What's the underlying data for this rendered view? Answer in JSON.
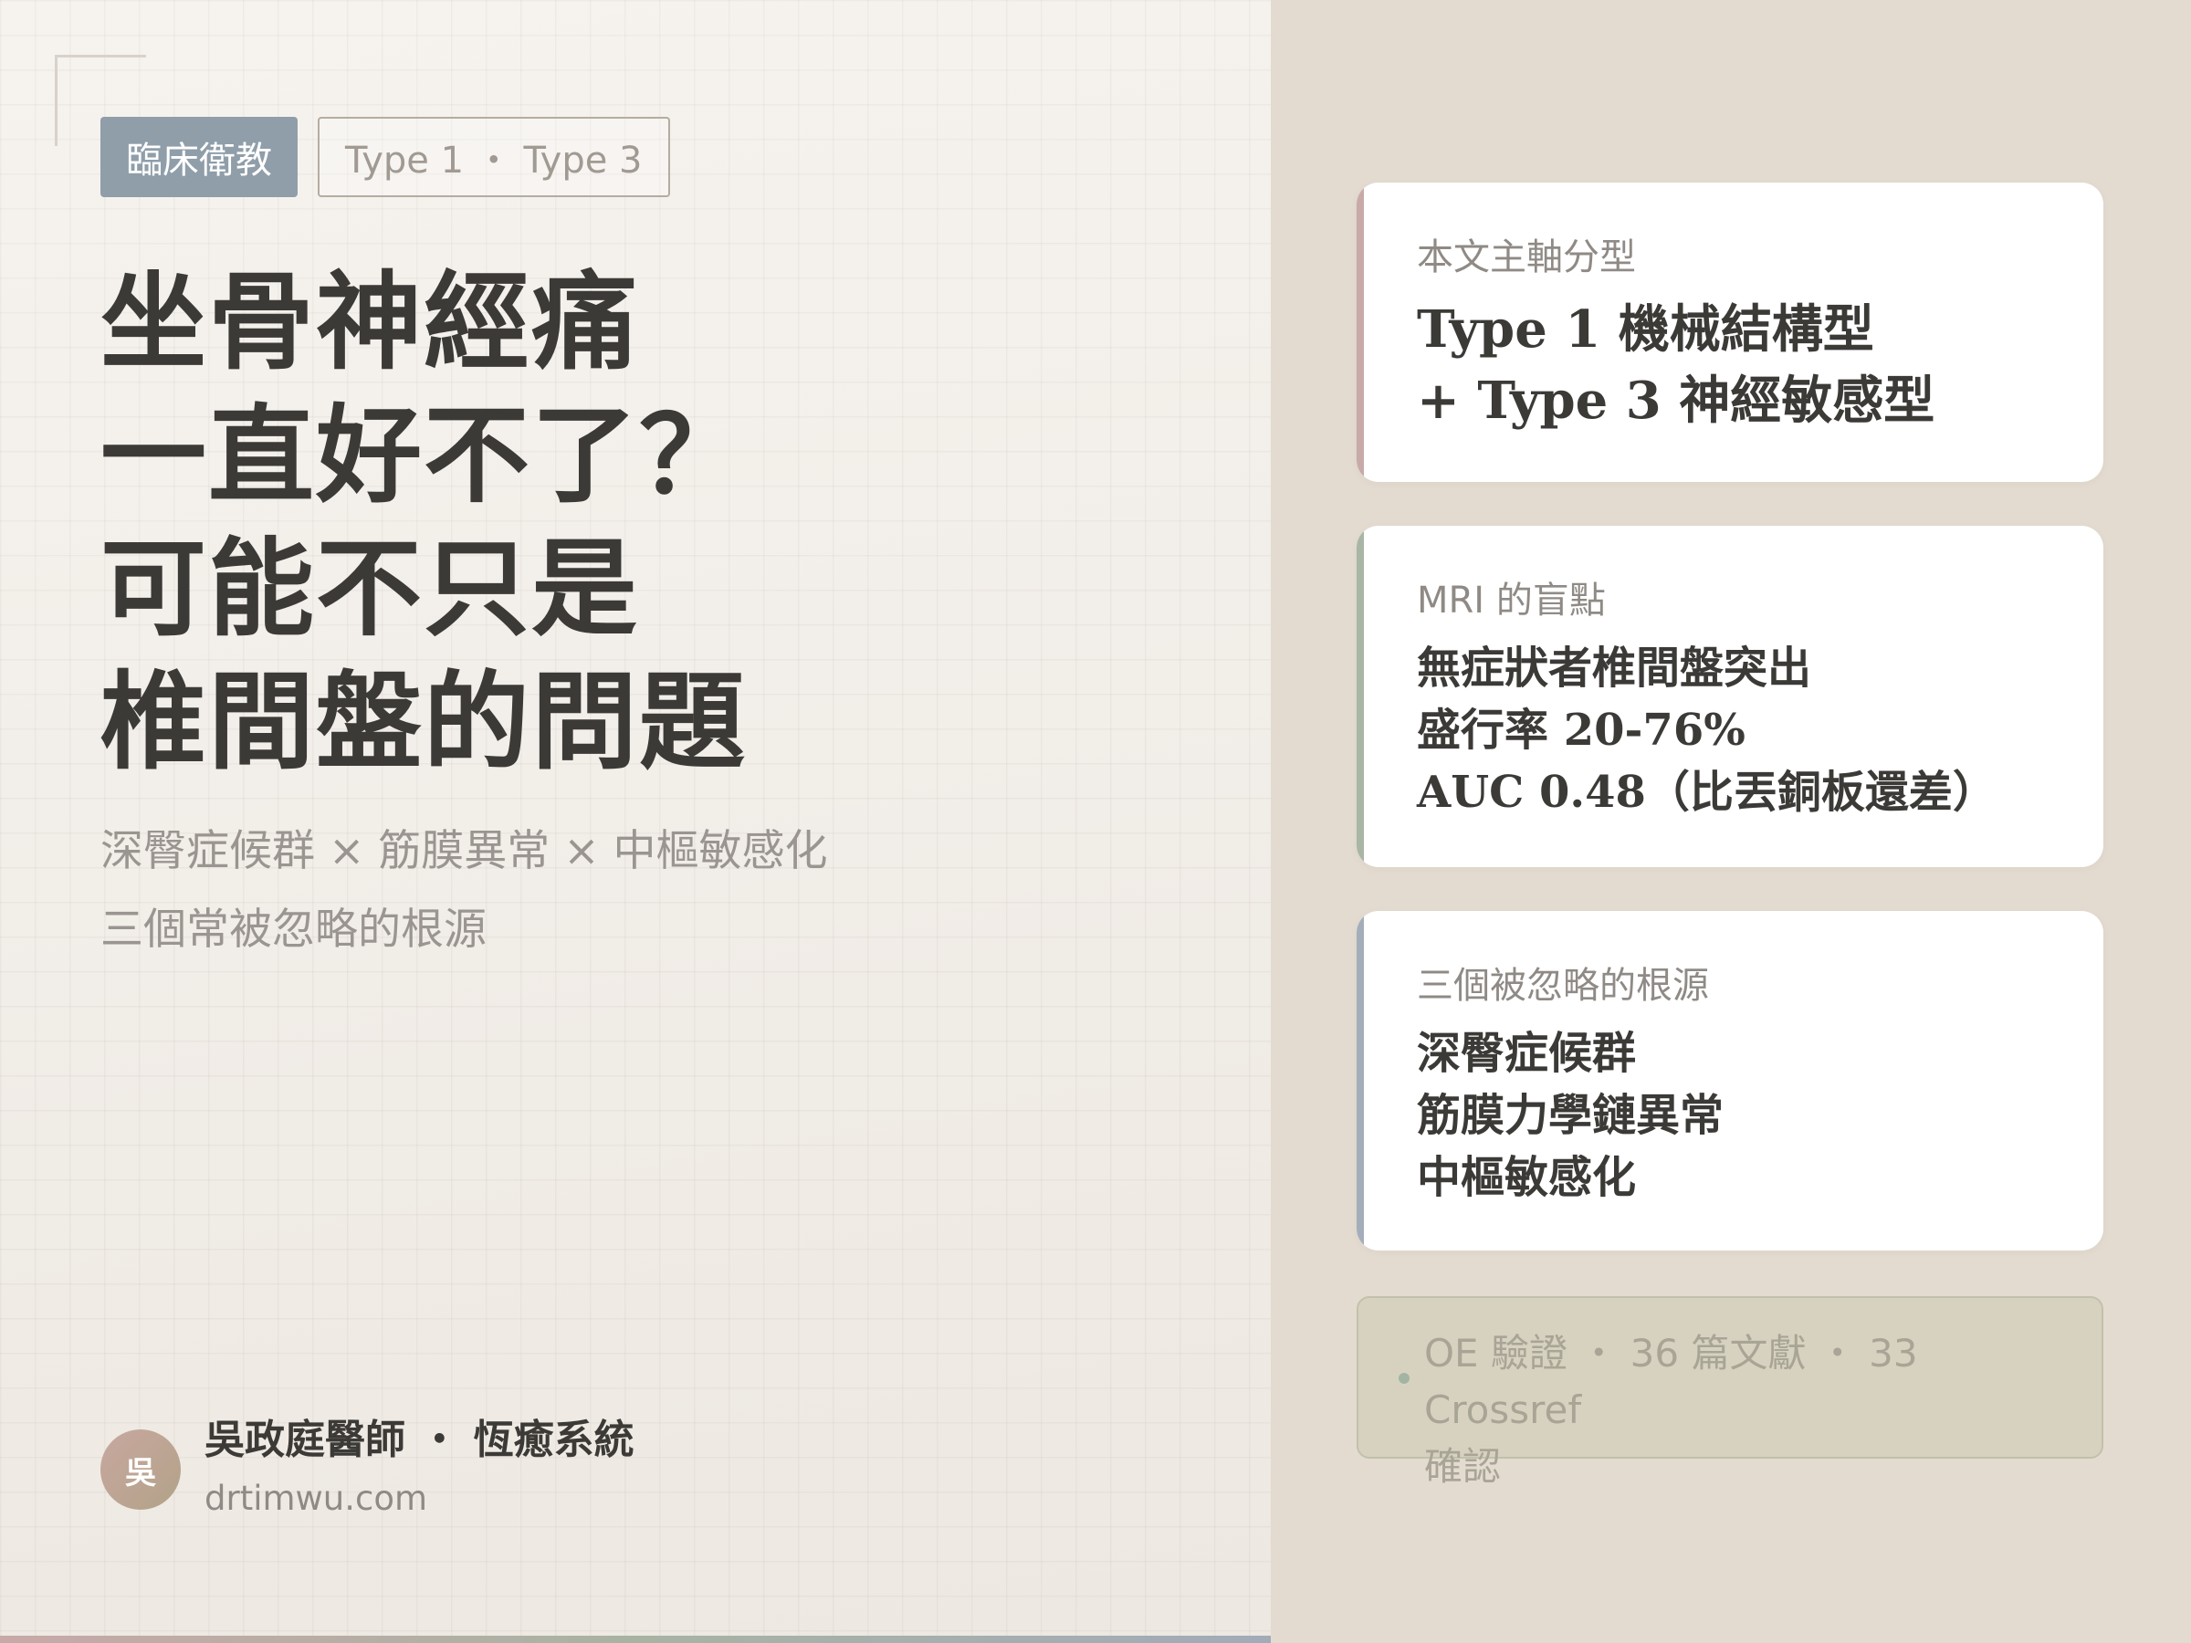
{
  "colors": {
    "tag_primary": "#8f9ea9",
    "title_text": "#3c3a37",
    "accent_rose": "#c8aaa9",
    "accent_sage": "#a9b5a5",
    "accent_slate": "#a4aebb",
    "right_panel_bg": "#e3dbd0"
  },
  "tags": {
    "primary": "臨床衛教",
    "secondary": "Type 1 ・ Type 3"
  },
  "title": {
    "lines": [
      "坐骨神經痛",
      "一直好不了？",
      "可能不只是",
      "椎間盤的問題"
    ]
  },
  "subtitle": {
    "line1": "深臀症候群 × 筋膜異常 × 中樞敏感化",
    "line2": "三個常被忽略的根源"
  },
  "author": {
    "avatar_text": "吳",
    "name": "吳政庭醫師 ・ 恆癒系統",
    "url": "drtimwu.com"
  },
  "cards": [
    {
      "label": "本文主軸分型",
      "lines": [
        "Type 1 機械結構型",
        "+ Type 3 神經敏感型"
      ]
    },
    {
      "label": "MRI 的盲點",
      "lines": [
        "無症狀者椎間盤突出",
        "盛行率 20-76%",
        "AUC 0.48（比丟銅板還差）"
      ]
    },
    {
      "label": "三個被忽略的根源",
      "lines": [
        "深臀症候群",
        "筋膜力學鏈異常",
        "中樞敏感化"
      ]
    }
  ],
  "note": {
    "line1": "OE 驗證 ・ 36 篇文獻 ・ 33 Crossref",
    "line2": "確認"
  }
}
